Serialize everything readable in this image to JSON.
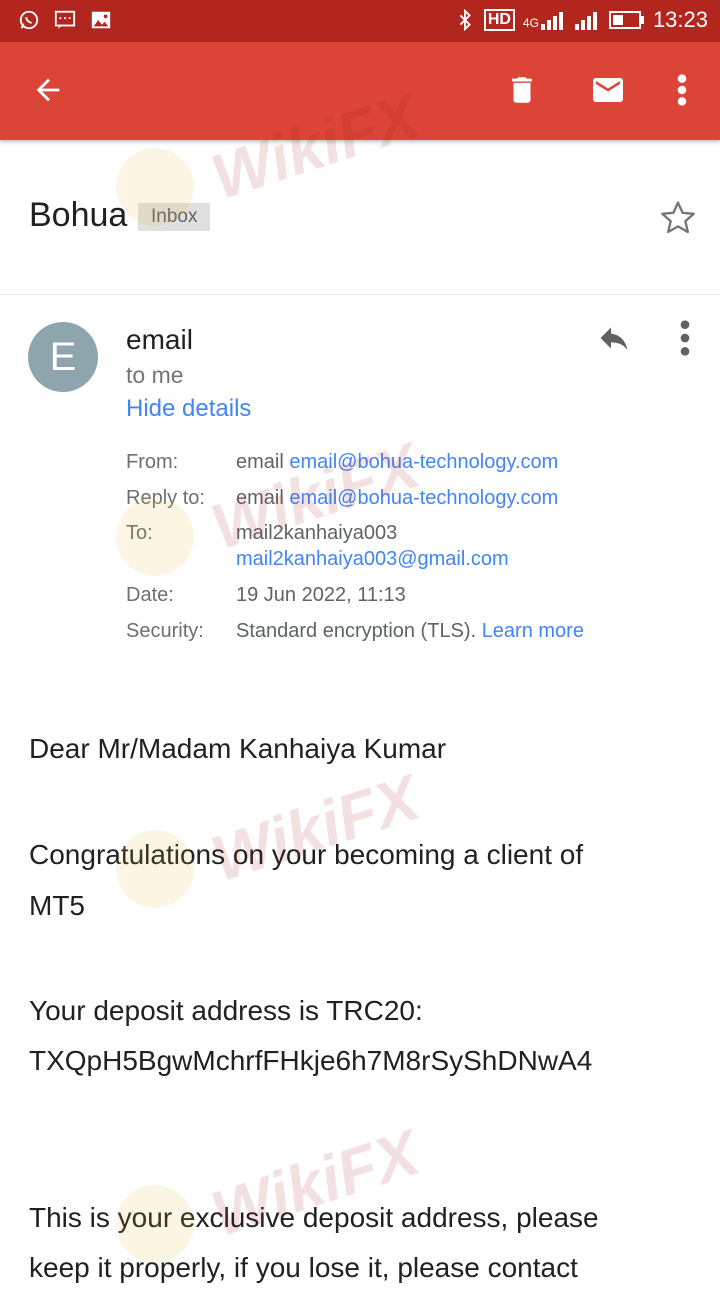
{
  "status_bar": {
    "time": "13:23",
    "left_icons": [
      "whatsapp-icon",
      "message-icon",
      "image-icon"
    ],
    "right_icons": [
      "bluetooth-icon",
      "hd-icon",
      "signal-4g-icon",
      "signal-icon",
      "battery-icon"
    ],
    "hd_label": "HD",
    "network_label": "4G"
  },
  "toolbar": {
    "back_icon": "arrow-left-icon",
    "delete_icon": "trash-icon",
    "mark_unread_icon": "mail-icon",
    "overflow_icon": "more-vert-icon"
  },
  "email": {
    "subject": "Bohua",
    "label": "Inbox",
    "avatar_letter": "E",
    "sender_name": "email",
    "recipient_summary": "to me",
    "hide_details": "Hide details",
    "details": {
      "from_label": "From:",
      "from_name": "email",
      "from_email": "email@bohua-technology.com",
      "reply_to_label": "Reply to:",
      "reply_to_name": "email",
      "reply_to_email": "email@bohua-technology.com",
      "to_label": "To:",
      "to_name": "mail2kanhaiya003",
      "to_email": "mail2kanhaiya003@gmail.com",
      "date_label": "Date:",
      "date_value": "19 Jun 2022, 11:13",
      "security_label": "Security:",
      "security_value": "Standard encryption (TLS).",
      "learn_more": "Learn more"
    },
    "body": {
      "greeting": "Dear Mr/Madam Kanhaiya Kumar",
      "p1_line1": "Congratulations on your becoming a client of",
      "p1_line2": "MT5",
      "p2_line1": "Your deposit address is TRC20:",
      "p2_line2": "TXQpH5BgwMchrfFHkje6h7M8rSyShDNwA4",
      "p3_line1": "This is your exclusive deposit address, please",
      "p3_line2": "keep it properly, if you lose it, please contact"
    }
  },
  "watermark": {
    "text": "WikiFX"
  },
  "colors": {
    "status_bar": "#b3261e",
    "app_bar": "#db4437",
    "link": "#4285f4",
    "avatar": "#8fa5ae"
  }
}
